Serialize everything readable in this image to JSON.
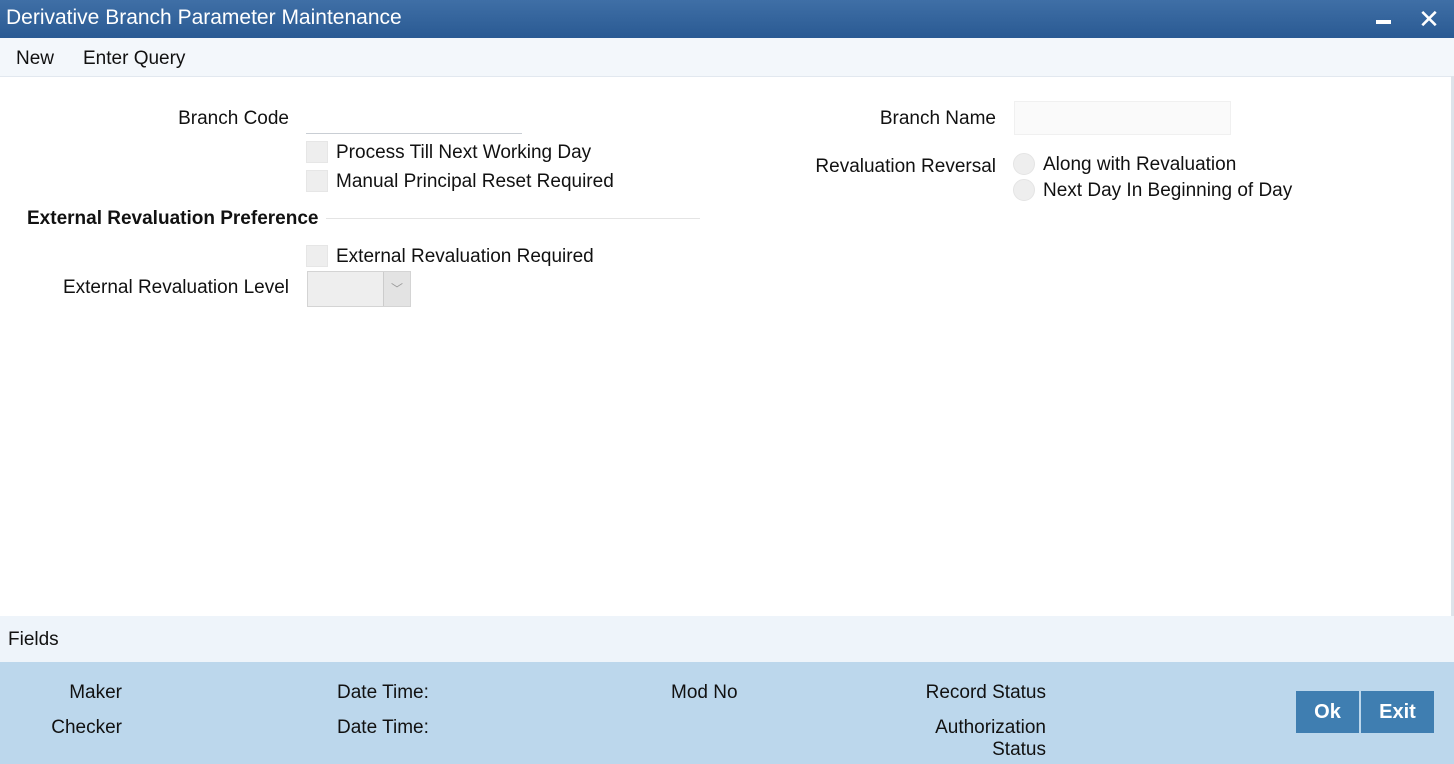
{
  "window": {
    "title": "Derivative Branch Parameter Maintenance",
    "minimize_icon": "minimize-icon",
    "close_icon": "close-icon",
    "close_glyph": "✕"
  },
  "menu": {
    "items": [
      {
        "label": "New"
      },
      {
        "label": "Enter Query"
      }
    ]
  },
  "form": {
    "branch_code": {
      "label": "Branch Code",
      "value": ""
    },
    "branch_name": {
      "label": "Branch Name",
      "value": ""
    },
    "process_till_next_working_day": {
      "label": "Process Till Next Working Day",
      "checked": false
    },
    "manual_principal_reset_required": {
      "label": "Manual Principal Reset Required",
      "checked": false
    },
    "revaluation_reversal": {
      "label": "Revaluation Reversal",
      "options": [
        {
          "label": "Along with Revaluation",
          "selected": false
        },
        {
          "label": "Next Day In Beginning of Day",
          "selected": false
        }
      ]
    },
    "external_revaluation_section": {
      "title": "External Revaluation Preference",
      "external_revaluation_required": {
        "label": "External Revaluation Required",
        "checked": false
      },
      "external_revaluation_level": {
        "label": "External Revaluation Level",
        "selected_value": ""
      }
    }
  },
  "fields_bar": {
    "label": "Fields"
  },
  "footer": {
    "maker": "Maker",
    "checker": "Checker",
    "date_time_1": "Date Time:",
    "date_time_2": "Date Time:",
    "mod_no": "Mod No",
    "record_status": "Record Status",
    "authorization_status_line1": "Authorization",
    "authorization_status_line2": "Status",
    "ok_button": "Ok",
    "exit_button": "Exit"
  },
  "colors": {
    "title_bar": "#2f5f97",
    "footer_bg": "#bcd7ec",
    "button_bg": "#3f7eb1"
  }
}
